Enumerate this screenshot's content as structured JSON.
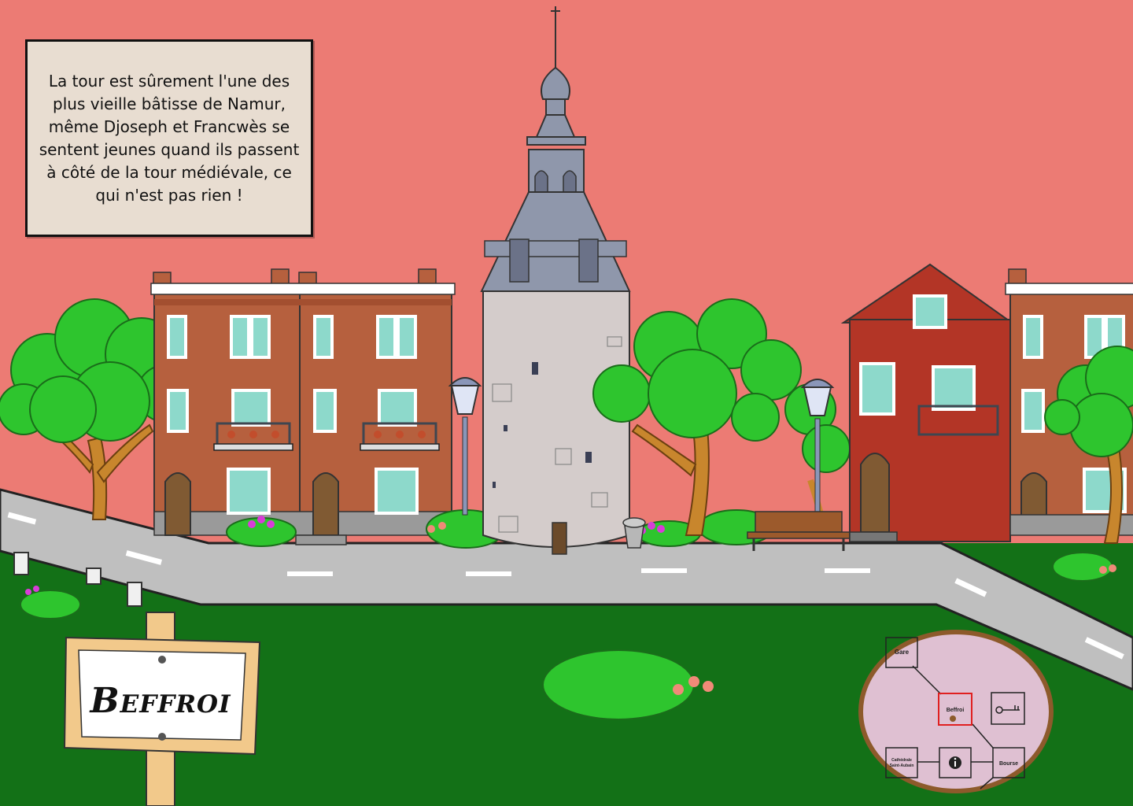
{
  "dialog": {
    "text": "La tour est sûrement l'une des plus vieille bâtisse de Namur, même Djoseph et Francwès se sentent jeunes quand ils passent à côté de la tour médiévale, ce qui n'est pas rien !"
  },
  "location_sign": {
    "label": "Beffroi"
  },
  "minimap": {
    "rooms": {
      "gare": "Gare",
      "beffroi": "Beffroi",
      "cathedrale_line1": "Cathédrale",
      "cathedrale_line2": "Saint-Aubain",
      "bourse": "Bourse"
    },
    "current_room": "Beffroi",
    "icons": [
      "key-icon",
      "info-icon",
      "player-marker-icon"
    ],
    "highlight_color": "#e02020"
  },
  "colors": {
    "sky": "#ec7b74",
    "grass": "#137117",
    "road": "#bdbdbd",
    "brick": "#b6603e",
    "red_house": "#b33526",
    "tower": "#d4cccb",
    "roof": "#8f97ab"
  }
}
